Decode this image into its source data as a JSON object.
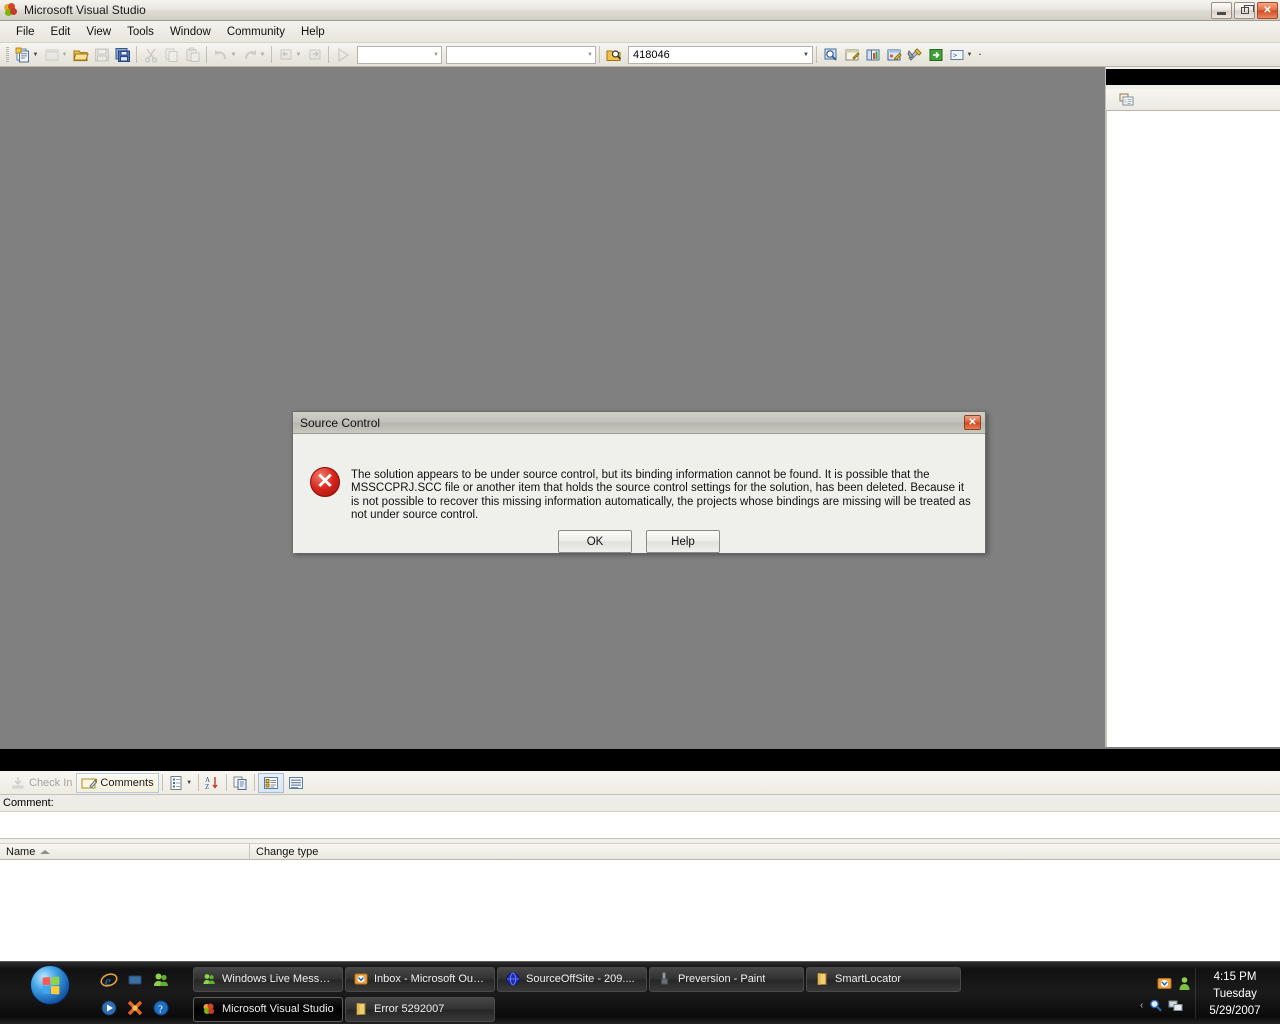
{
  "window": {
    "title": "Microsoft Visual Studio",
    "logo_icon": "visual-studio-logo-icon",
    "minimize_label": "",
    "maximize_label": "",
    "close_label": "✕"
  },
  "menubar": {
    "items": [
      {
        "label": "File"
      },
      {
        "label": "Edit"
      },
      {
        "label": "View"
      },
      {
        "label": "Tools"
      },
      {
        "label": "Window"
      },
      {
        "label": "Community"
      },
      {
        "label": "Help"
      }
    ]
  },
  "toolbar": {
    "buttons": [
      {
        "name": "new-project-icon",
        "enabled": true,
        "has_arrow": true
      },
      {
        "name": "add-new-item-icon",
        "enabled": false,
        "has_arrow": true
      },
      {
        "name": "open-file-icon",
        "enabled": true,
        "has_arrow": false
      },
      {
        "name": "save-icon",
        "enabled": false,
        "has_arrow": false
      },
      {
        "name": "save-all-icon",
        "enabled": true,
        "has_arrow": false
      },
      {
        "name": "cut-icon",
        "enabled": false,
        "has_arrow": false
      },
      {
        "name": "copy-icon",
        "enabled": false,
        "has_arrow": false
      },
      {
        "name": "paste-icon",
        "enabled": false,
        "has_arrow": false
      },
      {
        "name": "undo-icon",
        "enabled": false,
        "has_arrow": true
      },
      {
        "name": "redo-icon",
        "enabled": false,
        "has_arrow": true
      },
      {
        "name": "navigate-backward-icon",
        "enabled": false,
        "has_arrow": true
      },
      {
        "name": "navigate-forward-icon",
        "enabled": false,
        "has_arrow": false
      },
      {
        "name": "start-debug-icon",
        "enabled": false,
        "has_arrow": false
      }
    ],
    "solution_config_combo": {
      "value": "",
      "placeholder": ""
    },
    "solution_platform_combo": {
      "value": "",
      "placeholder": ""
    },
    "find_icon": "find-in-files-icon",
    "find_combo": {
      "value": "418046",
      "placeholder": ""
    },
    "right_buttons": [
      {
        "name": "find-symbol-icon"
      },
      {
        "name": "properties-window-icon"
      },
      {
        "name": "object-browser-icon"
      },
      {
        "name": "toolbox-icon"
      },
      {
        "name": "tools-options-icon"
      },
      {
        "name": "go-to-icon"
      },
      {
        "name": "command-window-icon",
        "has_arrow": true
      }
    ],
    "overflow_label": "⌄"
  },
  "right_panel": {
    "header_title": "",
    "toolbar_icon": "solution-explorer-icon"
  },
  "pending_changes": {
    "toolbar": {
      "check_in": {
        "label": "Check In",
        "icon": "check-in-icon",
        "enabled": false
      },
      "comments": {
        "label": "Comments",
        "icon": "comments-icon",
        "enabled": true,
        "active": true
      },
      "policy_warnings": {
        "icon": "policy-warnings-icon",
        "has_arrow": true
      },
      "sort": {
        "icon": "sort-ascending-icon"
      },
      "compare": {
        "icon": "compare-icon"
      },
      "details_view": {
        "icon": "details-view-icon",
        "toggled": true
      },
      "list_view": {
        "icon": "list-view-icon",
        "toggled": false
      }
    },
    "comment_label": "Comment:",
    "comment_value": "",
    "columns": [
      {
        "label": "Name",
        "sorted": true
      },
      {
        "label": "Change type",
        "sorted": false
      }
    ],
    "rows": []
  },
  "dialog": {
    "title": "Source Control",
    "close_label": "✕",
    "icon": "error-icon",
    "message": "The solution appears to be under source control, but its binding information cannot be found. It is possible that the MSSCCPRJ.SCC file or another item that holds the source control settings for the solution, has been deleted. Because it is not possible to recover this missing information automatically, the projects whose bindings are missing will be treated as not under source control.",
    "buttons": [
      {
        "label": "OK",
        "name": "ok-button"
      },
      {
        "label": "Help",
        "name": "help-button"
      }
    ]
  },
  "taskbar": {
    "start_label": "",
    "quick_launch": [
      {
        "name": "internet-explorer-icon"
      },
      {
        "name": "show-desktop-icon"
      },
      {
        "name": "windows-live-messenger-icon"
      },
      {
        "name": "media-player-icon"
      },
      {
        "name": "mozilla-firefox-icon"
      },
      {
        "name": "help-icon"
      }
    ],
    "quick_launch_more": "»",
    "tasks_row1": [
      {
        "label": "Windows Live Messen....",
        "icon": "messenger-icon",
        "active": false
      },
      {
        "label": "Inbox - Microsoft Out....",
        "icon": "outlook-icon",
        "active": false
      },
      {
        "label": "SourceOffSite - 209....",
        "icon": "sourceoffsite-icon",
        "active": false
      },
      {
        "label": "Preversion - Paint",
        "icon": "paint-icon",
        "active": false
      },
      {
        "label": "SmartLocator",
        "icon": "folder-icon",
        "active": false
      }
    ],
    "tasks_row2": [
      {
        "label": "Microsoft Visual Studio",
        "icon": "visual-studio-icon",
        "active": true
      },
      {
        "label": "Error 5292007",
        "icon": "folder-icon",
        "active": false
      }
    ],
    "tray": {
      "chevron": "‹",
      "icons": [
        {
          "name": "outlook-tray-icon"
        },
        {
          "name": "messenger-tray-icon"
        },
        {
          "name": "search-tray-icon"
        },
        {
          "name": "network-tray-icon"
        }
      ]
    },
    "clock": {
      "time": "4:15 PM",
      "day": "Tuesday",
      "date": "5/29/2007"
    }
  },
  "colors": {
    "accent": "#d8261c",
    "editor_bg": "#808080",
    "chrome": "#eceae1",
    "taskbar": "#111111"
  }
}
